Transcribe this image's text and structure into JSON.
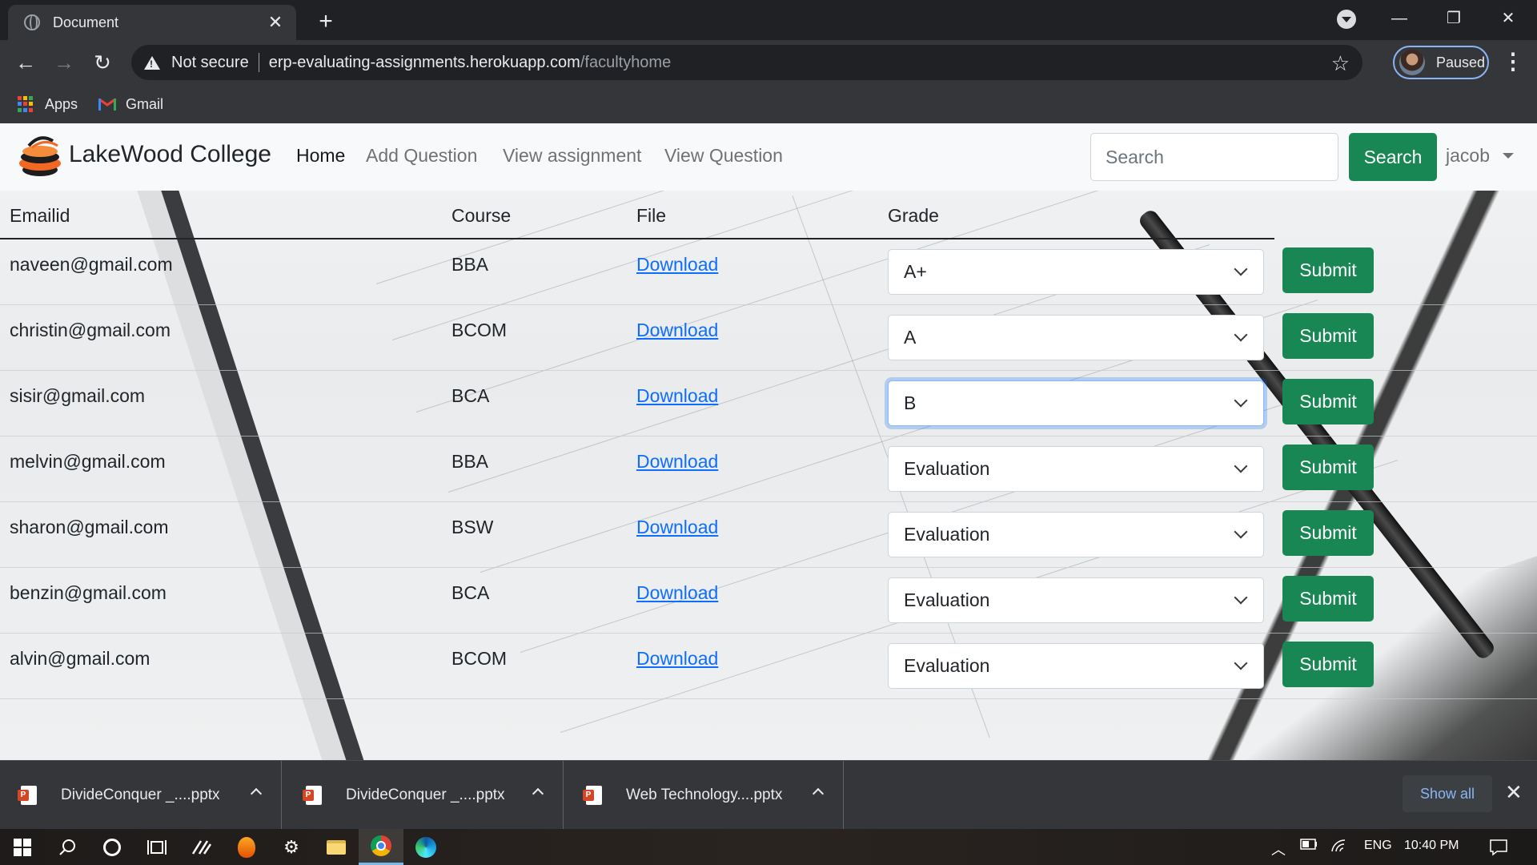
{
  "browser": {
    "tab_title": "Document",
    "tab_close": "✕",
    "new_tab": "+",
    "window_controls": {
      "minimize": "—",
      "restore": "❐",
      "close": "✕"
    },
    "nav": {
      "back": "←",
      "forward": "→",
      "reload": "↻"
    },
    "security_label": "Not secure",
    "url_host": "erp-evaluating-assignments.herokuapp.com",
    "url_path": "/facultyhome",
    "bookmark_star": "☆",
    "profile_status": "Paused",
    "menu": "⋮",
    "bookmarks": [
      {
        "label": "Apps",
        "icon": "apps-grid-icon"
      },
      {
        "label": "Gmail",
        "icon": "gmail-icon"
      }
    ]
  },
  "app": {
    "brand": "LakeWood College",
    "nav_links": [
      {
        "label": "Home",
        "active": true
      },
      {
        "label": "Add Question",
        "active": false
      },
      {
        "label": "View assignment",
        "active": false
      },
      {
        "label": "View Question",
        "active": false
      }
    ],
    "search": {
      "placeholder": "Search",
      "button_label": "Search"
    },
    "user": "jacob",
    "accent_color": "#198754",
    "link_color": "#0d6efd"
  },
  "table": {
    "headers": {
      "email": "Emailid",
      "course": "Course",
      "file": "File",
      "grade": "Grade"
    },
    "rows": [
      {
        "email": "naveen@gmail.com",
        "course": "BBA",
        "file": "Download",
        "grade": "A+",
        "submit": "Submit"
      },
      {
        "email": "christin@gmail.com",
        "course": "BCOM",
        "file": "Download",
        "grade": "A",
        "submit": "Submit"
      },
      {
        "email": "sisir@gmail.com",
        "course": "BCA",
        "file": "Download",
        "grade": "B",
        "submit": "Submit",
        "focused": true
      },
      {
        "email": "melvin@gmail.com",
        "course": "BBA",
        "file": "Download",
        "grade": "Evaluation",
        "submit": "Submit"
      },
      {
        "email": "sharon@gmail.com",
        "course": "BSW",
        "file": "Download",
        "grade": "Evaluation",
        "submit": "Submit"
      },
      {
        "email": "benzin@gmail.com",
        "course": "BCA",
        "file": "Download",
        "grade": "Evaluation",
        "submit": "Submit"
      },
      {
        "email": "alvin@gmail.com",
        "course": "BCOM",
        "file": "Download",
        "grade": "Evaluation",
        "submit": "Submit"
      }
    ]
  },
  "downloads": {
    "items": [
      {
        "name": "DivideConquer _....pptx"
      },
      {
        "name": "DivideConquer _....pptx"
      },
      {
        "name": "Web Technology....pptx"
      }
    ],
    "show_all": "Show all",
    "close": "✕"
  },
  "taskbar": {
    "language": "ENG",
    "time": "10:40 PM"
  }
}
